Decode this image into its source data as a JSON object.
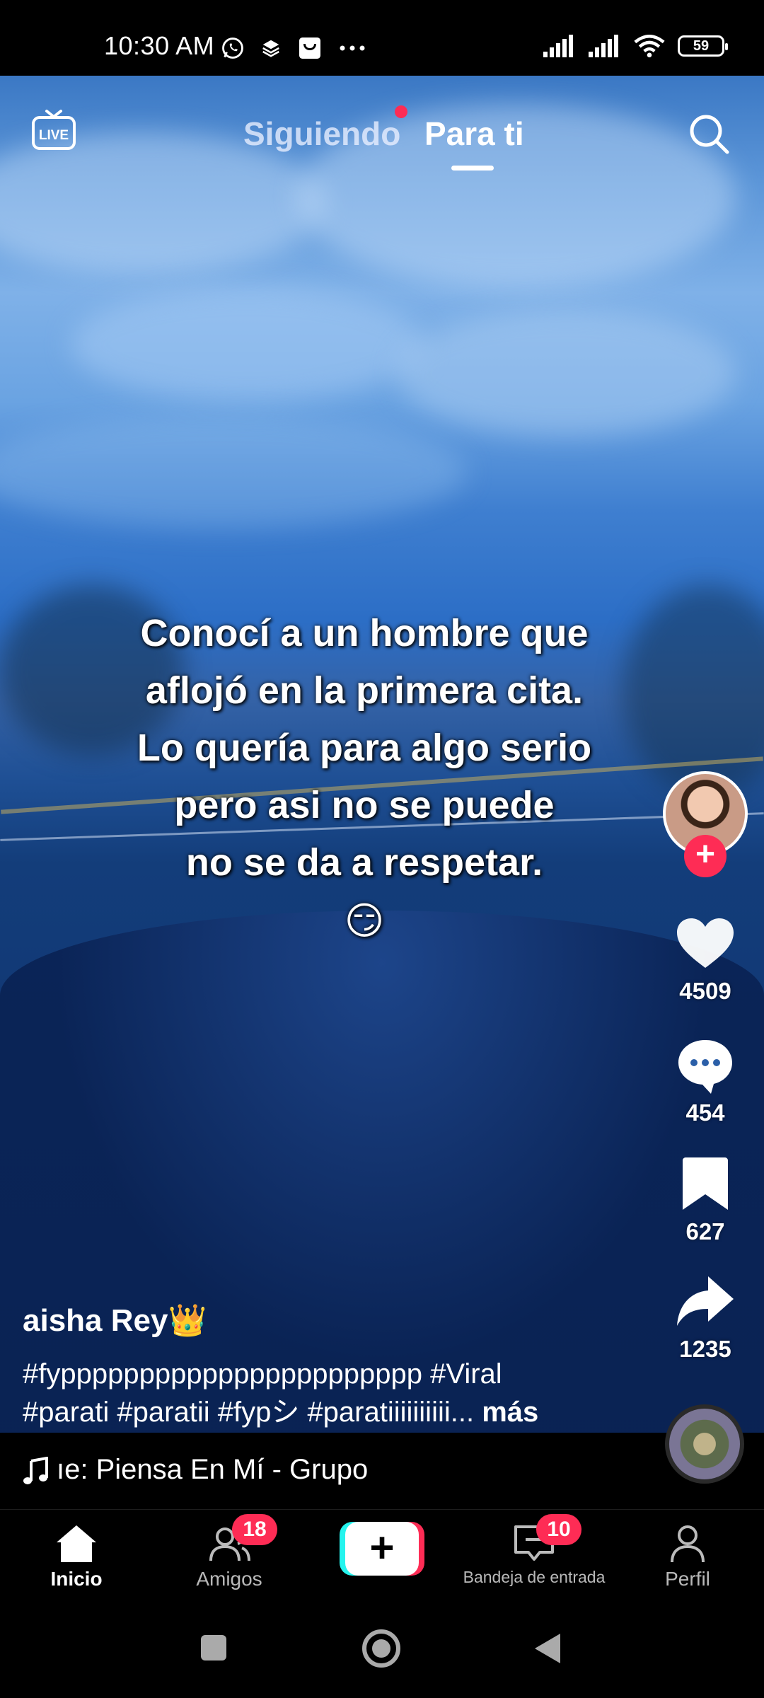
{
  "status_bar": {
    "time": "10:30 AM",
    "battery": "59",
    "icons": [
      "whatsapp-icon",
      "layers-icon",
      "shop-icon",
      "more-dots-icon",
      "signal-icon",
      "signal-icon",
      "wifi-icon",
      "battery-icon"
    ]
  },
  "top_nav": {
    "live_label": "LIVE",
    "tabs": [
      {
        "label": "Siguiendo",
        "active": false,
        "has_dot": true
      },
      {
        "label": "Para ti",
        "active": true
      }
    ]
  },
  "video": {
    "overlay_lines": [
      "Conocí a un hombre que",
      "aflojó en la primera cita.",
      "Lo quería para algo serio",
      "pero asi no se puede",
      "no se da a respetar."
    ],
    "overlay_emoji": "😏"
  },
  "actions": {
    "likes": "4509",
    "comments": "454",
    "saves": "627",
    "shares": "1235"
  },
  "post": {
    "username": "aisha Rey👑",
    "description_line1": "#fyppppppppppppppppppppppp #Viral",
    "description_line2": "#parati #paratii #fypシ #paratiiiiiiiiii...",
    "more_label": "más",
    "music": "ıe: Piensa En Mí - Grupo"
  },
  "tab_bar": {
    "items": [
      {
        "label": "Inicio",
        "active": true
      },
      {
        "label": "Amigos",
        "badge": "18"
      },
      {
        "label": "",
        "create": true
      },
      {
        "label": "Bandeja de entrada",
        "badge": "10"
      },
      {
        "label": "Perfil"
      }
    ]
  },
  "colors": {
    "accent": "#fe2c55",
    "cyan": "#25f4ee"
  }
}
